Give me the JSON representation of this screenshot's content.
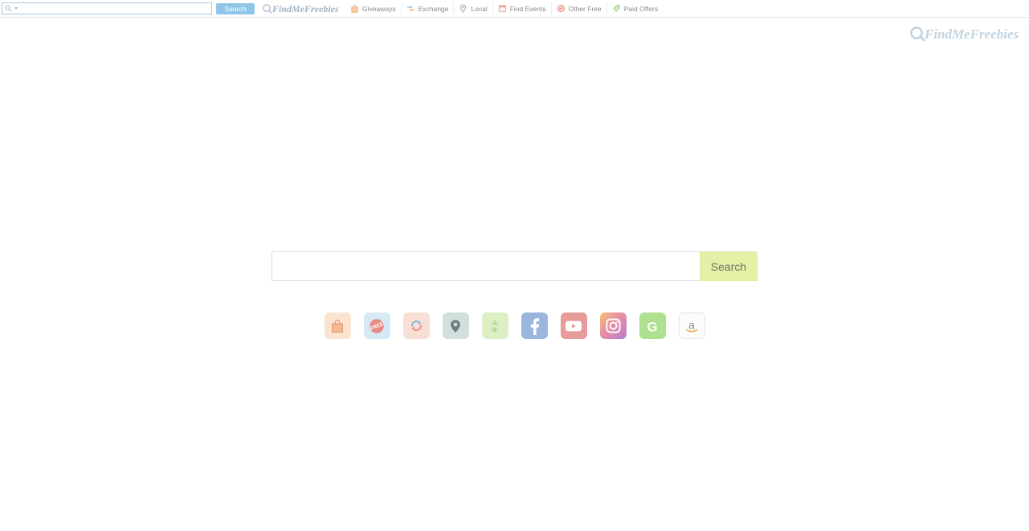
{
  "browser_toolbar": {
    "search_input_value": "",
    "search_input_placeholder": "",
    "search_button_label": "Search",
    "brand_text": "FindMeFreebies",
    "magnifier_icon": "search-icon",
    "dropdown_icon": "chevron-down-icon",
    "links": [
      {
        "label": "Giveaways",
        "icon": "shopping-bag-icon"
      },
      {
        "label": "Exchange",
        "icon": "exchange-arrows-icon"
      },
      {
        "label": "Local",
        "icon": "map-pin-icon"
      },
      {
        "label": "Find Events",
        "icon": "calendar-icon"
      },
      {
        "label": "Other Free",
        "icon": "free-badge-icon"
      },
      {
        "label": "Paid Offers",
        "icon": "dollar-tag-icon"
      }
    ]
  },
  "page": {
    "logo_text": "FindMeFreebies",
    "logo_trademark": "™",
    "logo_icon": "magnifier-icon"
  },
  "search": {
    "value": "",
    "placeholder": "",
    "button_label": "Search"
  },
  "shortcuts": [
    {
      "name": "giveaways",
      "icon": "shopping-bag-icon",
      "label": "Giveaways"
    },
    {
      "name": "free",
      "icon": "free-badge-icon",
      "label": "Free"
    },
    {
      "name": "exchange",
      "icon": "exchange-arrows-icon",
      "label": "Exchange"
    },
    {
      "name": "local",
      "icon": "map-pin-icon",
      "label": "Local"
    },
    {
      "name": "paid-offers",
      "icon": "dollar-sign-icon",
      "label": "Paid Offers"
    },
    {
      "name": "facebook",
      "icon": "facebook-icon",
      "label": "Facebook"
    },
    {
      "name": "youtube",
      "icon": "youtube-icon",
      "label": "YouTube"
    },
    {
      "name": "instagram",
      "icon": "instagram-icon",
      "label": "Instagram"
    },
    {
      "name": "groupon",
      "icon": "groupon-icon",
      "label": "Groupon"
    },
    {
      "name": "amazon",
      "icon": "amazon-icon",
      "label": "Amazon"
    }
  ],
  "colors": {
    "toolbar_button": "#8fc6e8",
    "search_button": "#e4f0a5",
    "toolbar_input_border": "#a9c7e4",
    "page_background": "#ffffff",
    "link_text": "#8a8a8a"
  }
}
